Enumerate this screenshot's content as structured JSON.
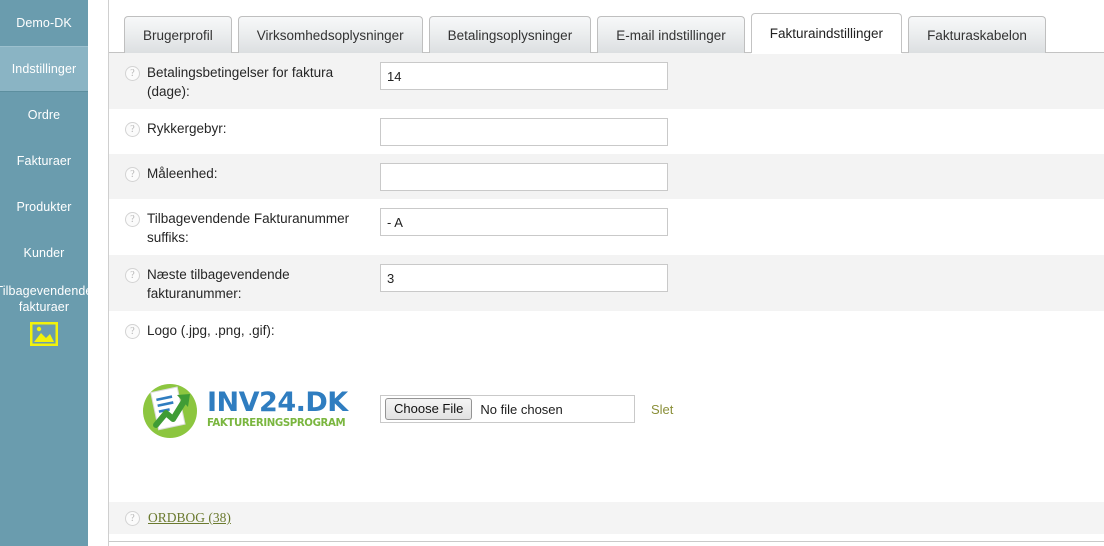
{
  "sidebar": {
    "items": [
      {
        "label": "Demo-DK",
        "active": false,
        "multiline": false
      },
      {
        "label": "Indstillinger",
        "active": true,
        "multiline": false
      },
      {
        "label": "Ordre",
        "active": false,
        "multiline": false
      },
      {
        "label": "Fakturaer",
        "active": false,
        "multiline": false
      },
      {
        "label": "Produkter",
        "active": false,
        "multiline": false
      },
      {
        "label": "Kunder",
        "active": false,
        "multiline": false
      },
      {
        "label": "Tilbagevendende fakturaer",
        "active": false,
        "multiline": true
      }
    ],
    "bottom_icon": "broken-image-icon",
    "bg_color": "#6a9cae",
    "active_color": "#8ab4c4"
  },
  "tabs": [
    {
      "label": "Brugerprofil",
      "active": false
    },
    {
      "label": "Virksomhedsoplysninger",
      "active": false
    },
    {
      "label": "Betalingsoplysninger",
      "active": false
    },
    {
      "label": "E-mail indstillinger",
      "active": false
    },
    {
      "label": "Fakturaindstillinger",
      "active": true
    },
    {
      "label": "Fakturaskabelon",
      "active": false
    }
  ],
  "form": {
    "help_icon": "?",
    "rows": [
      {
        "label": "Betalingsbetingelser for faktura (dage):",
        "value": "14",
        "placeholder": ""
      },
      {
        "label": "Rykkergebyr:",
        "value": "",
        "placeholder": ""
      },
      {
        "label": "Måleenhed:",
        "value": "",
        "placeholder": ""
      },
      {
        "label": "Tilbagevendende Fakturanummer suffiks:",
        "value": "- A",
        "placeholder": ""
      },
      {
        "label": "Næste tilbagevendende fakturanummer:",
        "value": "3",
        "placeholder": ""
      }
    ],
    "logo_label": "Logo (.jpg, .png, .gif):",
    "file_button": "Choose File",
    "file_status": "No file chosen",
    "delete_link": "Slet"
  },
  "logo": {
    "title": "INV24.DK",
    "subtitle": "FAKTURERINGSPROGRAM",
    "title_color": "#2f7dc0",
    "subtitle_color": "#7ab63f"
  },
  "footer": {
    "ordbog_label": "ORDBOG (38)",
    "link_color": "#6b7a2f"
  }
}
